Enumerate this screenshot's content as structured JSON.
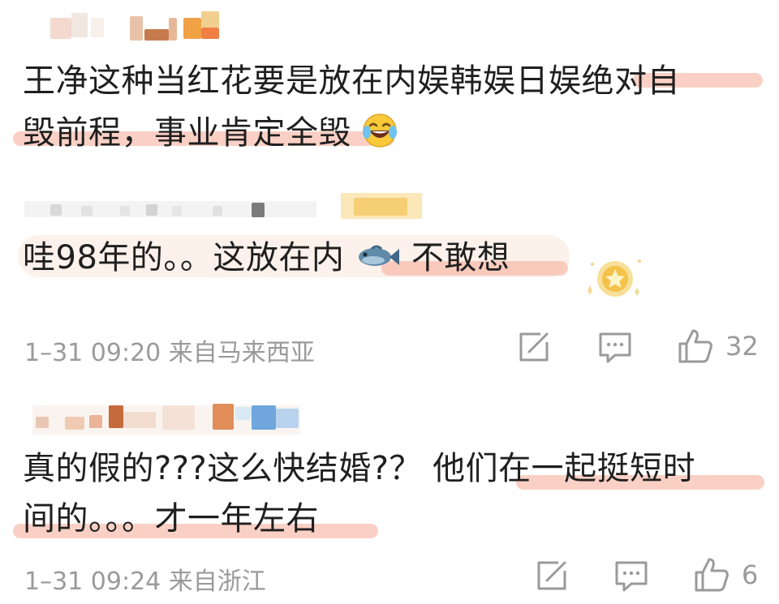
{
  "comments": [
    {
      "text_line1": "王净这种当红花要是放在内娱韩娱日娱绝对自",
      "text_line2": "毁前程，事业肯定全毁",
      "emoji": "laughing-tears-icon"
    },
    {
      "text_prefix": "哇98年的。。这放在内",
      "text_suffix": "不敢想",
      "inline_icon": "fish-icon",
      "badge_icon": "star-badge-icon",
      "meta": "1–31 09:20 来自马来西亚",
      "like_count": "32"
    },
    {
      "text_line1": "真的假的???这么快结婚?？ 他们在一起挺短时",
      "text_line2": "间的。。。才一年左右",
      "meta": "1–31 09:24 来自浙江",
      "like_count": "6"
    }
  ],
  "icons": {
    "share": "share-edit-icon",
    "comment": "comment-icon",
    "like": "thumbs-up-icon"
  },
  "colors": {
    "highlight": "#f6aa96",
    "meta_text": "#9a9a9a",
    "icon_stroke": "#9a9a9a"
  }
}
